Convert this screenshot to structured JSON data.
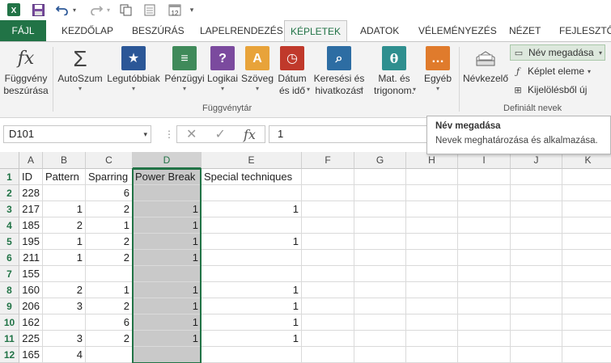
{
  "qat": {
    "icons": [
      "excel-logo-icon",
      "save-icon",
      "undo-icon",
      "redo-icon",
      "copy-format-icon",
      "touch-mode-icon",
      "calendar-icon",
      "customize-icon"
    ],
    "calendar_number": "12"
  },
  "tabs": [
    "FÁJL",
    "KEZDŐLAP",
    "BESZÚRÁS",
    "LAPELRENDEZÉS",
    "KÉPLETEK",
    "ADATOK",
    "VÉLEMÉNYEZÉS",
    "NÉZET",
    "FEJLESZTŐ"
  ],
  "active_tab": "KÉPLETEK",
  "ribbon": {
    "insert_function": {
      "line1": "Függvény",
      "line2": "beszúrása"
    },
    "buttons": [
      {
        "line1": "AutoSzum",
        "line2": "",
        "icon": "sigma-icon",
        "color": "#555555"
      },
      {
        "line1": "Legutóbbiak",
        "line2": "",
        "icon": "star-book-icon",
        "color": "#2b5797"
      },
      {
        "line1": "Pénzügyi",
        "line2": "",
        "icon": "coins-book-icon",
        "color": "#3f8a5a"
      },
      {
        "line1": "Logikai",
        "line2": "",
        "icon": "question-book-icon",
        "color": "#7b4a9e"
      },
      {
        "line1": "Szöveg",
        "line2": "",
        "icon": "text-book-icon",
        "color": "#e8a33a"
      },
      {
        "line1": "Dátum",
        "line2": "és idő",
        "icon": "clock-book-icon",
        "color": "#c0392b"
      },
      {
        "line1": "Keresési és",
        "line2": "hivatkozási",
        "icon": "lookup-book-icon",
        "color": "#2d6da3"
      },
      {
        "line1": "Mat. és",
        "line2": "trigonom.",
        "icon": "theta-book-icon",
        "color": "#2f8f8f"
      },
      {
        "line1": "Egyéb",
        "line2": "",
        "icon": "more-book-icon",
        "color": "#e07b2c"
      }
    ],
    "library_group_label": "Függvénytár",
    "name_manager": "Névkezelő",
    "define_name": "Név megadása",
    "use_in_formula": "Képlet eleme",
    "create_from_selection": "Kijelölésből új",
    "defined_names_group_label": "Definiált nevek"
  },
  "formula_bar": {
    "name_box": "D101",
    "value": "1",
    "fx": "fx"
  },
  "tooltip": {
    "title": "Név megadása",
    "description": "Nevek meghatározása és alkalmazása."
  },
  "columns": [
    "A",
    "B",
    "C",
    "D",
    "E",
    "F",
    "G",
    "H",
    "I",
    "J",
    "K"
  ],
  "selected_column": "D",
  "rows": [
    {
      "n": "1",
      "A": "ID",
      "B": "Pattern",
      "C": "Sparring",
      "D": "Power Break",
      "E": "Special techniques"
    },
    {
      "n": "2",
      "A": "228",
      "B": "",
      "C": "6",
      "D": "",
      "E": ""
    },
    {
      "n": "3",
      "A": "217",
      "B": "1",
      "C": "2",
      "D": "1",
      "E": "1"
    },
    {
      "n": "4",
      "A": "185",
      "B": "2",
      "C": "1",
      "D": "1",
      "E": ""
    },
    {
      "n": "5",
      "A": "195",
      "B": "1",
      "C": "2",
      "D": "1",
      "E": "1"
    },
    {
      "n": "6",
      "A": "211",
      "B": "1",
      "C": "2",
      "D": "1",
      "E": ""
    },
    {
      "n": "7",
      "A": "155",
      "B": "",
      "C": "",
      "D": "",
      "E": ""
    },
    {
      "n": "8",
      "A": "160",
      "B": "2",
      "C": "1",
      "D": "1",
      "E": "1"
    },
    {
      "n": "9",
      "A": "206",
      "B": "3",
      "C": "2",
      "D": "1",
      "E": "1"
    },
    {
      "n": "10",
      "A": "162",
      "B": "",
      "C": "6",
      "D": "1",
      "E": "1"
    },
    {
      "n": "11",
      "A": "225",
      "B": "3",
      "C": "2",
      "D": "1",
      "E": "1"
    },
    {
      "n": "12",
      "A": "165",
      "B": "4",
      "C": "",
      "D": "",
      "E": ""
    }
  ],
  "colors": {
    "excel_green": "#217346",
    "selection_fill": "#c9c9c9"
  }
}
